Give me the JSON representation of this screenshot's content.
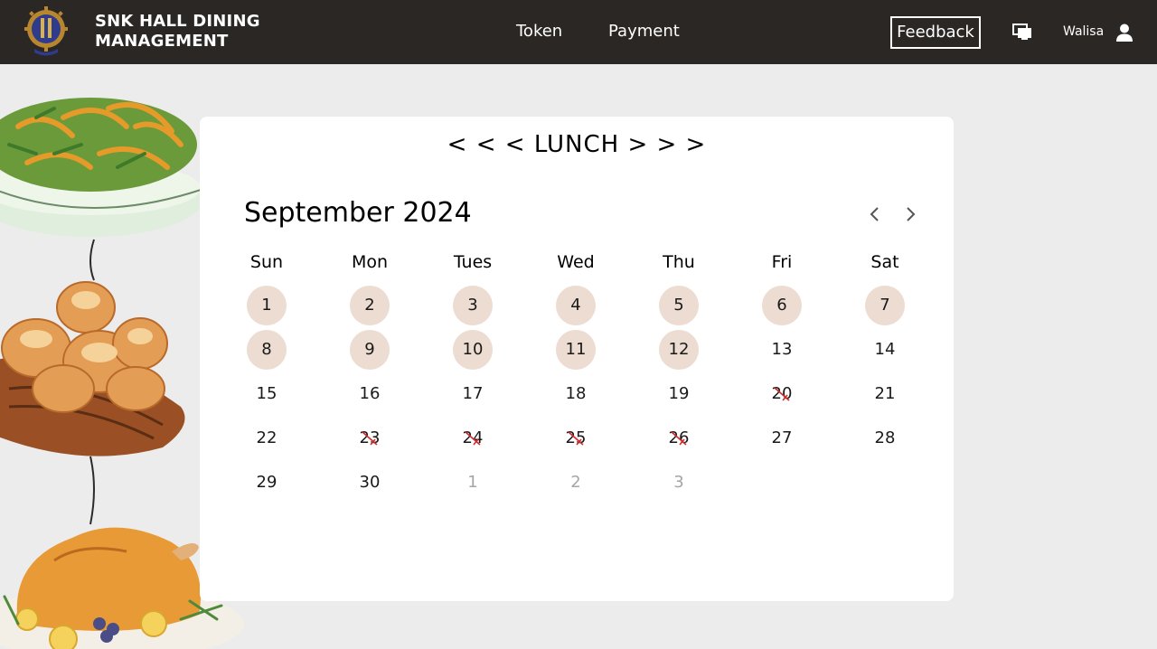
{
  "header": {
    "brand_line1": "SNK HALL DINING",
    "brand_line2": "MANAGEMENT",
    "nav": [
      {
        "label": "Token"
      },
      {
        "label": "Payment"
      }
    ],
    "feedback_label": "Feedback",
    "username": "Walisa",
    "icons": [
      "logo-icon",
      "monitor-icon",
      "user-icon"
    ]
  },
  "meal_selector": {
    "prev_arrows": "< < <",
    "meal": "LUNCH",
    "next_arrows": "> > >"
  },
  "calendar": {
    "month_label": "September 2024",
    "weekdays": [
      "Sun",
      "Mon",
      "Tues",
      "Wed",
      "Thu",
      "Fri",
      "Sat"
    ],
    "weeks": [
      [
        {
          "d": "1",
          "s": "booked"
        },
        {
          "d": "2",
          "s": "booked"
        },
        {
          "d": "3",
          "s": "booked"
        },
        {
          "d": "4",
          "s": "booked"
        },
        {
          "d": "5",
          "s": "booked"
        },
        {
          "d": "6",
          "s": "booked"
        },
        {
          "d": "7",
          "s": "booked"
        }
      ],
      [
        {
          "d": "8",
          "s": "booked"
        },
        {
          "d": "9",
          "s": "booked"
        },
        {
          "d": "10",
          "s": "booked"
        },
        {
          "d": "11",
          "s": "booked"
        },
        {
          "d": "12",
          "s": "booked"
        },
        {
          "d": "13",
          "s": "normal"
        },
        {
          "d": "14",
          "s": "normal"
        }
      ],
      [
        {
          "d": "15",
          "s": "normal"
        },
        {
          "d": "16",
          "s": "normal"
        },
        {
          "d": "17",
          "s": "normal"
        },
        {
          "d": "18",
          "s": "normal"
        },
        {
          "d": "19",
          "s": "normal"
        },
        {
          "d": "20",
          "s": "crossed"
        },
        {
          "d": "21",
          "s": "normal"
        }
      ],
      [
        {
          "d": "22",
          "s": "normal"
        },
        {
          "d": "23",
          "s": "crossed"
        },
        {
          "d": "24",
          "s": "crossed"
        },
        {
          "d": "25",
          "s": "crossed"
        },
        {
          "d": "26",
          "s": "crossed"
        },
        {
          "d": "27",
          "s": "normal"
        },
        {
          "d": "28",
          "s": "normal"
        }
      ],
      [
        {
          "d": "29",
          "s": "normal"
        },
        {
          "d": "30",
          "s": "normal"
        },
        {
          "d": "1",
          "s": "other"
        },
        {
          "d": "2",
          "s": "other"
        },
        {
          "d": "3",
          "s": "other"
        }
      ]
    ],
    "colors": {
      "booked_bg": "#ecdcd1",
      "cross": "#d12a2a",
      "header_bg": "#2b2725"
    }
  }
}
